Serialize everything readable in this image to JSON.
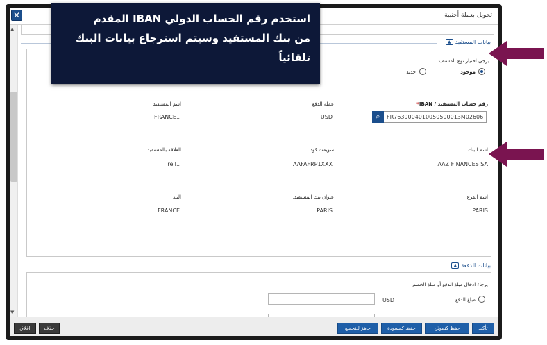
{
  "window": {
    "title": "تحويل بعملة أجنبية",
    "close_label": "✕"
  },
  "callout": {
    "line1": "استخدم رقم الحساب الدولي  IBAN  المقدم",
    "line2": "من بنك المستفيد وسيتم استرجاع بيانات البنك تلقائياً"
  },
  "beneficiary": {
    "section_title": "بيانات المستفيد",
    "toggle_label": "▲",
    "type_prompt": "يرجى اختيار نوع المستفيد",
    "type_options": [
      "موجود",
      "جديد"
    ],
    "type_selected": "موجود",
    "fields": {
      "iban_label": "رقم حساب المستفيد / IBAN",
      "iban_required": "*",
      "iban_value": "FR7630004010050500013M02606",
      "payment_currency_label": "عملة الدفع",
      "payment_currency_value": "USD",
      "beneficiary_name_label": "اسم المستفيد",
      "beneficiary_name_value": "FRANCE1",
      "bank_name_label": "اسم البنك",
      "bank_name_value": "AAZ FINANCES SA",
      "swift_label": "سويفت كود",
      "swift_value": "AAFAFRP1XXX",
      "relationship_label": "العلاقة بالمستفيد",
      "relationship_value": "rell1",
      "branch_label": "اسم الفرع",
      "branch_value": "PARIS",
      "bank_address_label": "عنوان بنك المستفيد.",
      "bank_address_value": "PARIS",
      "country_label": "البلد",
      "country_value": "FRANCE"
    }
  },
  "payment": {
    "section_title": "بيانات الدفعة",
    "toggle_label": "▲",
    "prompt": "يرجاء ادخال مبلغ الدفع أو مبلغ الخصم",
    "amount_option_label": "مبلغ الدفع",
    "amount_currency": "USD",
    "amount_value": ""
  },
  "footer": {
    "confirm": "تأكيد",
    "save_template": "حفظ كنموذج",
    "save_draft": "حفظ كمسودة",
    "ready": "جاهز للتجميع",
    "delete": "حذف",
    "close": "اغلاق"
  },
  "colors": {
    "accent": "#1f5fa8",
    "callout_bg": "#0d1838",
    "arrow": "#7a1450"
  }
}
